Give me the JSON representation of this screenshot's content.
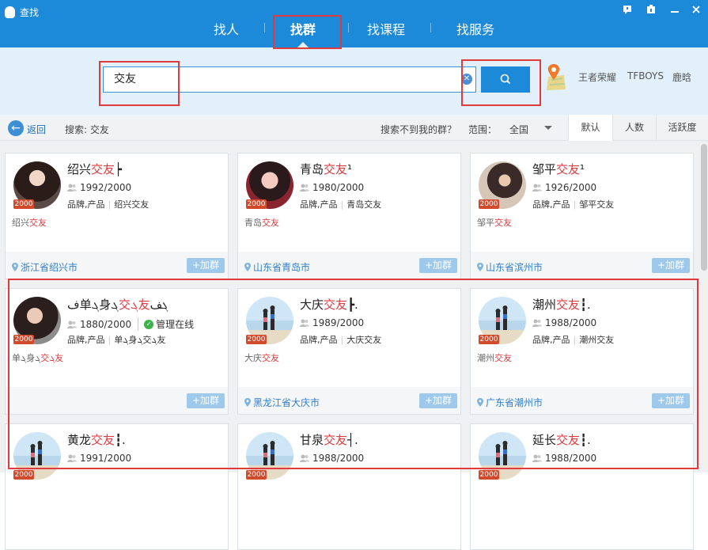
{
  "window": {
    "title": "查找"
  },
  "tabs": [
    {
      "label": "找人"
    },
    {
      "label": "找群"
    },
    {
      "label": "找课程"
    },
    {
      "label": "找服务"
    }
  ],
  "search": {
    "value": "交友"
  },
  "hot_words": [
    "王者荣耀",
    "TFBOYS",
    "鹿晗"
  ],
  "toolbar": {
    "back": "返回",
    "search_label": "搜索: 交友",
    "not_found": "搜索不到我的群？",
    "range_label": "范围：",
    "range_value": "全国",
    "sort_tabs": [
      "默认",
      "人数",
      "活跃度"
    ]
  },
  "join_label": "+加群",
  "level_badge": "2000",
  "groups": [
    {
      "name_pre": "绍兴",
      "name_hl": "交友",
      "name_post": "┝",
      "members": "1992/2000",
      "tags": "品牌,产品",
      "tag2": "绍兴交友",
      "desc_pre": "绍兴",
      "desc_hl": "交友",
      "location": "浙江省绍兴市",
      "online": ""
    },
    {
      "name_pre": "青岛",
      "name_hl": "交友",
      "name_post": "¹",
      "members": "1980/2000",
      "tags": "品牌,产品",
      "tag2": "青岛交友",
      "desc_pre": "青岛",
      "desc_hl": "交友",
      "location": "山东省青岛市",
      "online": ""
    },
    {
      "name_pre": "邹平",
      "name_hl": "交友",
      "name_post": "¹",
      "members": "1926/2000",
      "tags": "品牌,产品",
      "tag2": "邹平交友",
      "desc_pre": "邹平",
      "desc_hl": "交友",
      "location": "山东省滨州市",
      "online": ""
    },
    {
      "name_pre": "ف单ܓ身ܓ",
      "name_hl": "交ܓ友",
      "name_post": "ܓف",
      "members": "1880/2000",
      "tags": "品牌,产品",
      "tag2": "单ܓ身ܓ交ܓ友",
      "desc_pre": "单ܓ身ܓ",
      "desc_hl": "交ܓ友",
      "location": "",
      "online": "管理在线"
    },
    {
      "name_pre": "大庆",
      "name_hl": "交友",
      "name_post": "┣.",
      "members": "1989/2000",
      "tags": "品牌,产品",
      "tag2": "大庆交友",
      "desc_pre": "大庆",
      "desc_hl": "交友",
      "location": "黑龙江省大庆市",
      "online": ""
    },
    {
      "name_pre": "潮州",
      "name_hl": "交友",
      "name_post": "┇.",
      "members": "1988/2000",
      "tags": "品牌,产品",
      "tag2": "潮州交友",
      "desc_pre": "潮州",
      "desc_hl": "交友",
      "location": "广东省潮州市",
      "online": ""
    },
    {
      "name_pre": "黄龙",
      "name_hl": "交友",
      "name_post": "┇.",
      "members": "1991/2000",
      "tags": "",
      "tag2": "",
      "desc_pre": "",
      "desc_hl": "",
      "location": "",
      "online": ""
    },
    {
      "name_pre": "甘泉",
      "name_hl": "交友",
      "name_post": "┤.",
      "members": "1988/2000",
      "tags": "",
      "tag2": "",
      "desc_pre": "",
      "desc_hl": "",
      "location": "",
      "online": ""
    },
    {
      "name_pre": "延长",
      "name_hl": "交友",
      "name_post": "┇.",
      "members": "1988/2000",
      "tags": "",
      "tag2": "",
      "desc_pre": "",
      "desc_hl": "",
      "location": "",
      "online": ""
    }
  ],
  "colors": {
    "header": "#1d8ad9",
    "search_bg": "#e1f0fa",
    "highlight": "#e0393e",
    "annotation": "#e0393e",
    "link": "#2f7fc9"
  }
}
